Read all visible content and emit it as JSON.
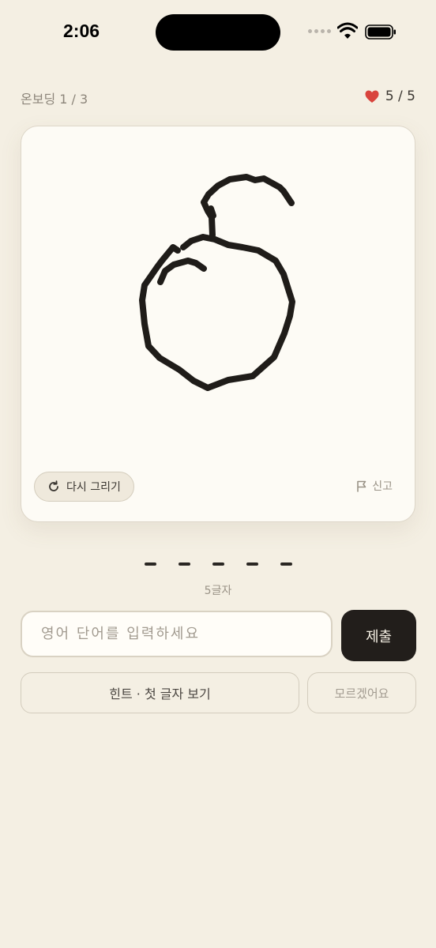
{
  "status_bar": {
    "time": "2:06",
    "icons": [
      "signal-icon",
      "wifi-icon",
      "battery-icon"
    ]
  },
  "header": {
    "progress_label": "온보딩 1 / 3",
    "lives": "5 / 5",
    "heart_color": "#d9443d"
  },
  "canvas": {
    "redraw_label": "다시 그리기",
    "report_label": "신고",
    "stroke_color": "#1f1c19"
  },
  "answer": {
    "blank_count": 5,
    "letter_count_label": "5글자",
    "input_placeholder": "영어 단어를 입력하세요",
    "input_value": "",
    "submit_label": "제출"
  },
  "actions": {
    "hint_label": "힌트 · 첫 글자 보기",
    "dont_know_label": "모르겠어요"
  }
}
